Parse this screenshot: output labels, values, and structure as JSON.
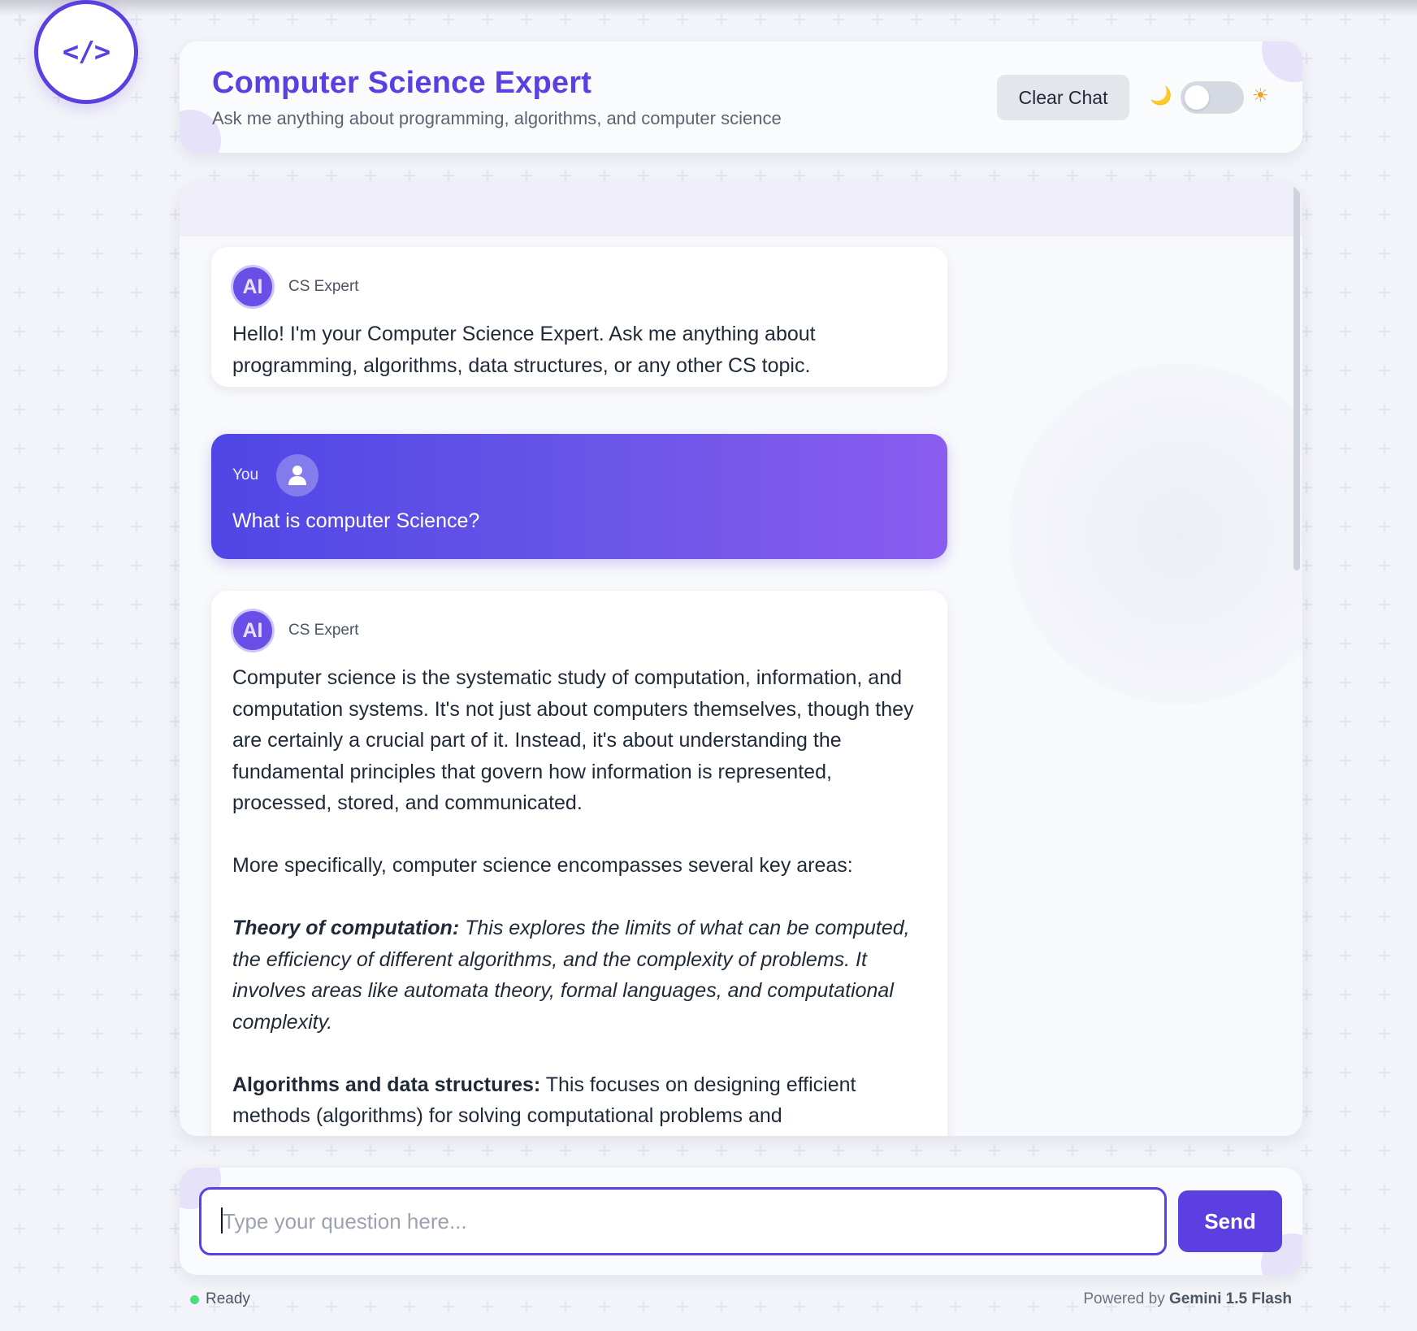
{
  "logo": {
    "glyph": "</>"
  },
  "header": {
    "title": "Computer Science Expert",
    "subtitle": "Ask me anything about programming, algorithms, and computer science",
    "clear_label": "Clear Chat",
    "moon_icon": "moon-icon",
    "sun_icon": "sun-icon"
  },
  "messages": [
    {
      "role": "ai",
      "avatar": "AI",
      "sender": "CS Expert",
      "text": "Hello! I'm your Computer Science Expert. Ask me anything about programming, algorithms, data structures, or any other CS topic."
    },
    {
      "role": "user",
      "sender": "You",
      "text": "What is computer Science?"
    },
    {
      "role": "ai",
      "avatar": "AI",
      "sender": "CS Expert",
      "paragraphs": [
        "Computer science is the systematic study of computation, information, and computation systems. It's not just about computers themselves, though they are certainly a crucial part of it. Instead, it's about understanding the fundamental principles that govern how information is represented, processed, stored, and communicated.",
        "More specifically, computer science encompasses several key areas:"
      ],
      "topics": [
        {
          "heading": "Theory of computation:",
          "body": " This explores the limits of what can be computed, the efficiency of different algorithms, and the complexity of problems. It involves areas like automata theory, formal languages, and computational complexity."
        },
        {
          "heading": "Algorithms and data structures:",
          "body": " This focuses on designing efficient methods (algorithms) for solving computational problems and"
        }
      ]
    }
  ],
  "input": {
    "placeholder": "Type your question here...",
    "value": ""
  },
  "send_label": "Send",
  "footer": {
    "status": "Ready",
    "powered_prefix": "Powered by",
    "model": "Gemini 1.5 Flash"
  },
  "colors": {
    "accent": "#5b3fe0",
    "user_bubble_start": "#4f46e5",
    "user_bubble_end": "#8b5cf0",
    "status_ready": "#4ade80"
  }
}
